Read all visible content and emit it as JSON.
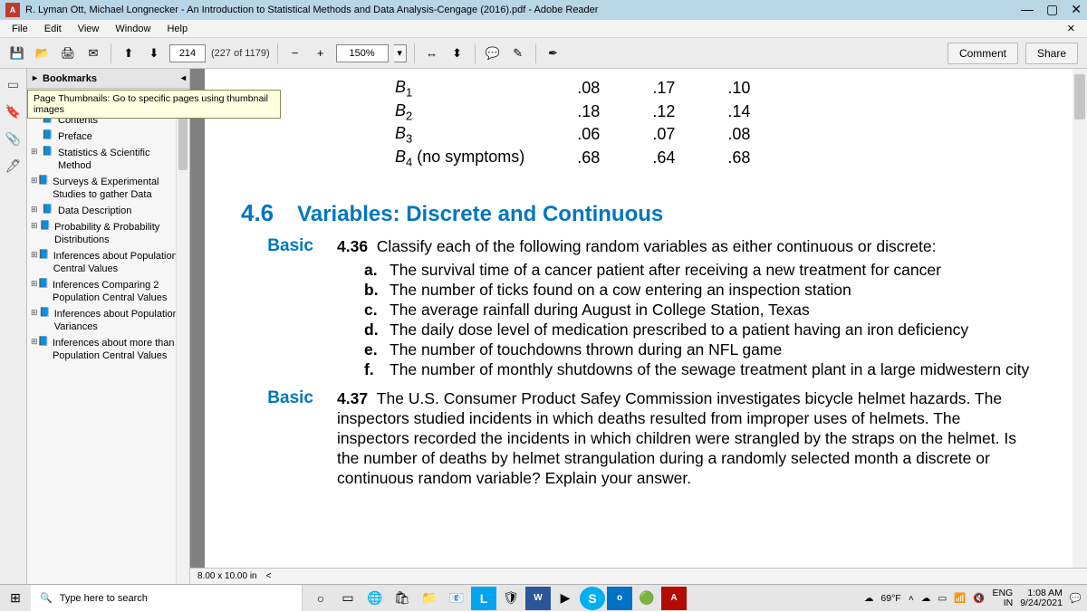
{
  "window": {
    "title": "R. Lyman Ott, Michael Longnecker - An Introduction to Statistical Methods and Data Analysis-Cengage (2016).pdf - Adobe Reader"
  },
  "menubar": [
    "File",
    "Edit",
    "View",
    "Window",
    "Help"
  ],
  "toolbar": {
    "page_input": "214",
    "page_count": "(227 of 1179)",
    "zoom": "150%",
    "comment": "Comment",
    "share": "Share"
  },
  "navpane": {
    "header": "Bookmarks",
    "tooltip": "Page Thumbnails: Go to specific pages using thumbnail images",
    "items": [
      {
        "exp": "",
        "label": "Contents"
      },
      {
        "exp": "",
        "label": "Preface"
      },
      {
        "exp": "⊞",
        "label": "Statistics & Scientific Method"
      },
      {
        "exp": "⊞",
        "label": "Surveys & Experimental Studies to gather Data"
      },
      {
        "exp": "⊞",
        "label": "Data Description"
      },
      {
        "exp": "⊞",
        "label": "Probability & Probability Distributions"
      },
      {
        "exp": "⊞",
        "label": "Inferences about Population Central Values"
      },
      {
        "exp": "⊞",
        "label": "Inferences Comparing 2 Population Central Values"
      },
      {
        "exp": "⊞",
        "label": "Inferences about Population Variances"
      },
      {
        "exp": "⊞",
        "label": "Inferences about more than 2 Population Central Values"
      }
    ]
  },
  "doc": {
    "table": [
      [
        "B",
        "1",
        "",
        ".08",
        ".17",
        ".10"
      ],
      [
        "B",
        "2",
        "",
        ".18",
        ".12",
        ".14"
      ],
      [
        "B",
        "3",
        "",
        ".06",
        ".07",
        ".08"
      ],
      [
        "B",
        "4",
        " (no symptoms)",
        ".68",
        ".64",
        ".68"
      ]
    ],
    "secnum": "4.6",
    "sectitle": "Variables: Discrete and Continuous",
    "p436": {
      "label": "Basic",
      "num": "4.36",
      "intro": "Classify each of the following random variables as either continuous or discrete:",
      "items": [
        "The survival time of a cancer patient after receiving a new treatment for cancer",
        "The number of ticks found on a cow entering an inspection station",
        "The average rainfall during August in College Station, Texas",
        "The daily dose level of medication prescribed to a patient having an iron deficiency",
        "The number of touchdowns thrown during an NFL game",
        "The number of monthly shutdowns of the sewage treatment plant in a large midwestern city"
      ]
    },
    "p437": {
      "label": "Basic",
      "num": "4.37",
      "body": "The U.S. Consumer Product Safey Commission investigates bicycle helmet hazards. The inspectors studied incidents in which deaths resulted from improper uses of helmets. The inspectors recorded the incidents in which children were strangled by the straps on the helmet. Is the number of deaths by helmet strangulation during a randomly selected month a discrete or continuous random variable? Explain your answer."
    },
    "pagesize": "8.00 x 10.00 in"
  },
  "taskbar": {
    "search_placeholder": "Type here to search",
    "weather": "69°F",
    "lang1": "ENG",
    "lang2": "IN",
    "time": "1:08 AM",
    "date": "9/24/2021"
  }
}
